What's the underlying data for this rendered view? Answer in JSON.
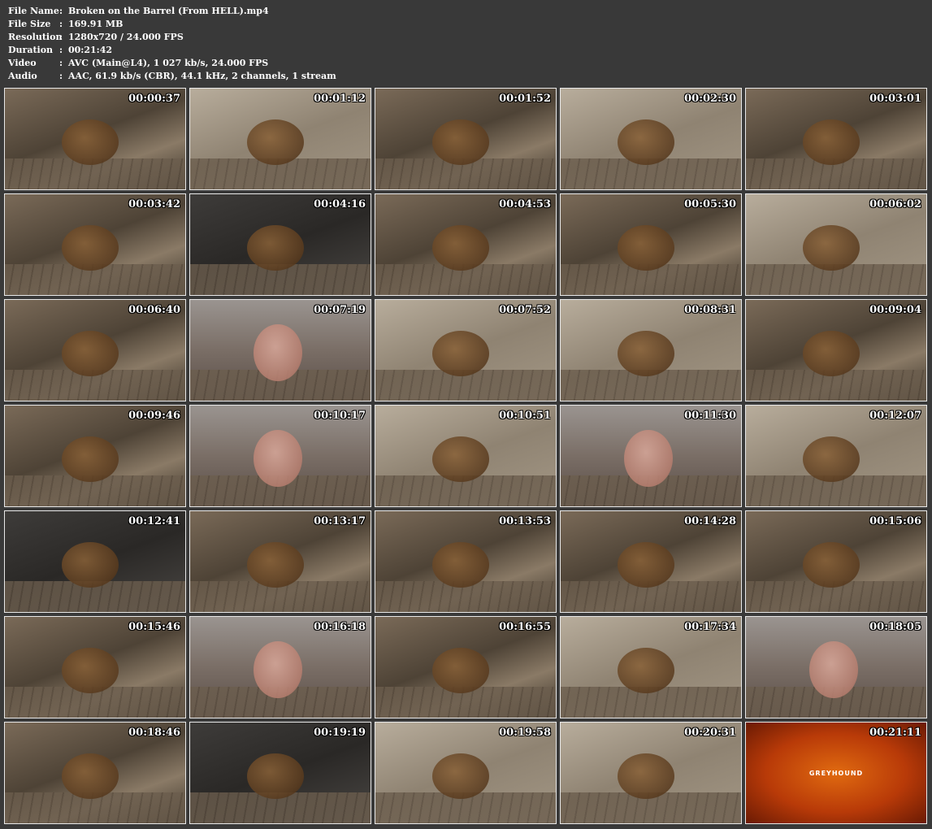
{
  "info": [
    {
      "key": "File Name",
      "sep": ":",
      "value": "Broken on the Barrel (From HELL).mp4"
    },
    {
      "key": "File Size",
      "sep": ":",
      "value": "169.91 MB"
    },
    {
      "key": "Resolution",
      "sep": ":",
      "value": "1280x720 / 24.000 FPS"
    },
    {
      "key": "Duration",
      "sep": ":",
      "value": "00:21:42"
    },
    {
      "key": "Video",
      "sep": ":",
      "value": "AVC (Main@L4), 1 027 kb/s, 24.000 FPS"
    },
    {
      "key": "Audio",
      "sep": ":",
      "value": "AAC, 61.9 kb/s (CBR), 44.1 kHz, 2 channels, 1 stream"
    }
  ],
  "thumbnails": [
    {
      "time": "00:00:37",
      "style": "normal"
    },
    {
      "time": "00:01:12",
      "style": "light"
    },
    {
      "time": "00:01:52",
      "style": "normal"
    },
    {
      "time": "00:02:30",
      "style": "light"
    },
    {
      "time": "00:03:01",
      "style": "normal"
    },
    {
      "time": "00:03:42",
      "style": "normal"
    },
    {
      "time": "00:04:16",
      "style": "dark"
    },
    {
      "time": "00:04:53",
      "style": "normal"
    },
    {
      "time": "00:05:30",
      "style": "normal"
    },
    {
      "time": "00:06:02",
      "style": "light"
    },
    {
      "time": "00:06:40",
      "style": "normal"
    },
    {
      "time": "00:07:19",
      "style": "face"
    },
    {
      "time": "00:07:52",
      "style": "light"
    },
    {
      "time": "00:08:31",
      "style": "light"
    },
    {
      "time": "00:09:04",
      "style": "normal"
    },
    {
      "time": "00:09:46",
      "style": "normal"
    },
    {
      "time": "00:10:17",
      "style": "face"
    },
    {
      "time": "00:10:51",
      "style": "light"
    },
    {
      "time": "00:11:30",
      "style": "face"
    },
    {
      "time": "00:12:07",
      "style": "light"
    },
    {
      "time": "00:12:41",
      "style": "dark"
    },
    {
      "time": "00:13:17",
      "style": "normal"
    },
    {
      "time": "00:13:53",
      "style": "normal"
    },
    {
      "time": "00:14:28",
      "style": "normal"
    },
    {
      "time": "00:15:06",
      "style": "normal"
    },
    {
      "time": "00:15:46",
      "style": "normal"
    },
    {
      "time": "00:16:18",
      "style": "face"
    },
    {
      "time": "00:16:55",
      "style": "normal"
    },
    {
      "time": "00:17:34",
      "style": "light"
    },
    {
      "time": "00:18:05",
      "style": "face"
    },
    {
      "time": "00:18:46",
      "style": "normal"
    },
    {
      "time": "00:19:19",
      "style": "dark"
    },
    {
      "time": "00:19:58",
      "style": "light"
    },
    {
      "time": "00:20:31",
      "style": "light"
    },
    {
      "time": "00:21:11",
      "style": "red",
      "caption": "GREYHOUND"
    }
  ]
}
